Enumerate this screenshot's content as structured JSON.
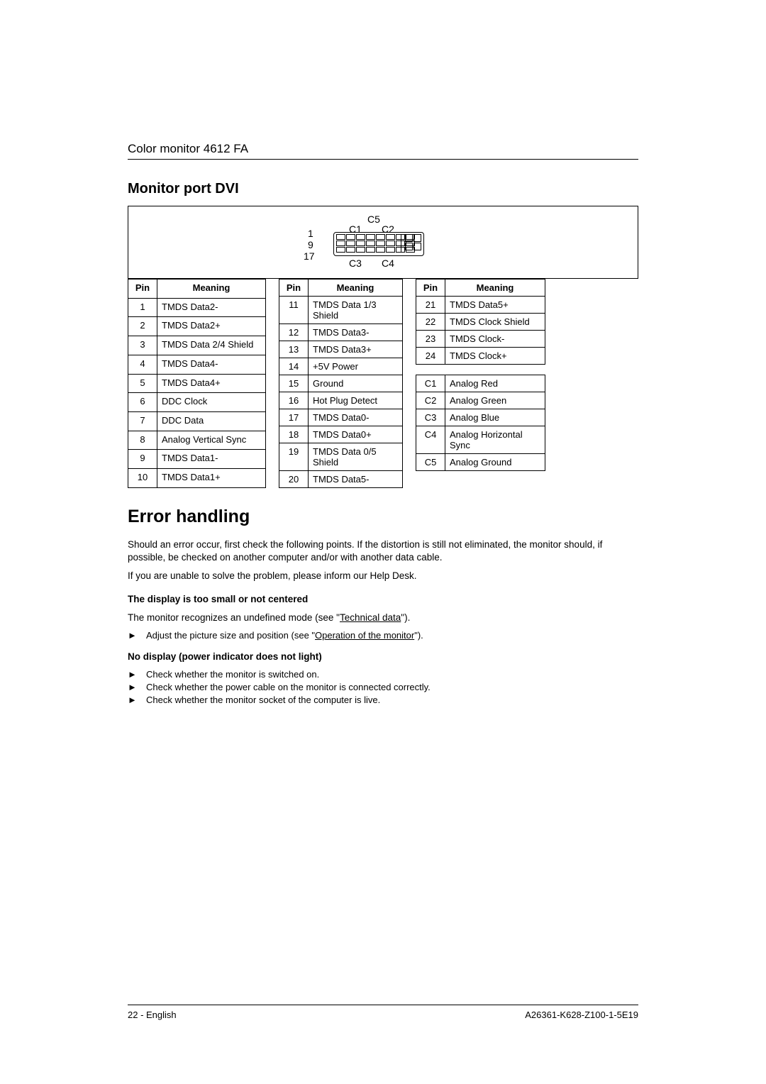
{
  "header": {
    "product": "Color monitor 4612 FA"
  },
  "section1": {
    "title": "Monitor port DVI"
  },
  "diagram": {
    "labels": {
      "l1": "1",
      "l9": "9",
      "l17": "17",
      "c1": "C1",
      "c2": "C2",
      "c3": "C3",
      "c4": "C4",
      "c5": "C5"
    }
  },
  "table_headers": {
    "pin": "Pin",
    "meaning": "Meaning"
  },
  "table1": [
    {
      "pin": "1",
      "meaning": "TMDS Data2-"
    },
    {
      "pin": "2",
      "meaning": "TMDS Data2+"
    },
    {
      "pin": "3",
      "meaning": "TMDS Data 2/4 Shield"
    },
    {
      "pin": "4",
      "meaning": "TMDS Data4-"
    },
    {
      "pin": "5",
      "meaning": "TMDS Data4+"
    },
    {
      "pin": "6",
      "meaning": "DDC Clock"
    },
    {
      "pin": "7",
      "meaning": "DDC Data"
    },
    {
      "pin": "8",
      "meaning": "Analog Vertical Sync"
    },
    {
      "pin": "9",
      "meaning": "TMDS Data1-"
    },
    {
      "pin": "10",
      "meaning": "TMDS Data1+"
    }
  ],
  "table2": [
    {
      "pin": "11",
      "meaning": "TMDS Data 1/3 Shield"
    },
    {
      "pin": "12",
      "meaning": "TMDS Data3-"
    },
    {
      "pin": "13",
      "meaning": "TMDS Data3+"
    },
    {
      "pin": "14",
      "meaning": "+5V Power"
    },
    {
      "pin": "15",
      "meaning": "Ground"
    },
    {
      "pin": "16",
      "meaning": "Hot Plug Detect"
    },
    {
      "pin": "17",
      "meaning": "TMDS Data0-"
    },
    {
      "pin": "18",
      "meaning": "TMDS Data0+"
    },
    {
      "pin": "19",
      "meaning": "TMDS Data 0/5 Shield"
    },
    {
      "pin": "20",
      "meaning": "TMDS Data5-"
    }
  ],
  "table3": [
    {
      "pin": "21",
      "meaning": "TMDS Data5+"
    },
    {
      "pin": "22",
      "meaning": "TMDS Clock Shield"
    },
    {
      "pin": "23",
      "meaning": "TMDS Clock-"
    },
    {
      "pin": "24",
      "meaning": "TMDS Clock+"
    }
  ],
  "table4": [
    {
      "pin": "C1",
      "meaning": "Analog Red"
    },
    {
      "pin": "C2",
      "meaning": "Analog Green"
    },
    {
      "pin": "C3",
      "meaning": "Analog Blue"
    },
    {
      "pin": "C4",
      "meaning": "Analog Horizontal Sync"
    },
    {
      "pin": "C5",
      "meaning": "Analog Ground"
    }
  ],
  "section2": {
    "title": "Error handling",
    "intro1": "Should an error occur, first check the following points. If the distortion is still not eliminated, the monitor should, if possible, be checked on another computer and/or with another data cable.",
    "intro2": "If you are unable to solve the problem, please inform our Help Desk.",
    "sub1_title": "The display is too small or not centered",
    "sub1_text_pre": "The monitor recognizes an undefined mode (see \"",
    "sub1_link": "Technical data",
    "sub1_text_post": "\").",
    "sub1_bullet_pre": "Adjust the picture size and position (see \"",
    "sub1_bullet_link": "Operation of the monitor",
    "sub1_bullet_post": "\").",
    "sub2_title": "No display (power indicator does not light)",
    "sub2_bullets": [
      "Check whether the monitor is switched on.",
      "Check whether the power cable on the monitor is connected correctly.",
      "Check whether the monitor socket of the computer is live."
    ]
  },
  "footer": {
    "left": "22 - English",
    "right": "A26361-K628-Z100-1-5E19"
  },
  "chart_data": {
    "type": "table",
    "title": "DVI connector pinout",
    "groups": [
      {
        "columns": [
          "Pin",
          "Meaning"
        ],
        "rows": [
          [
            "1",
            "TMDS Data2-"
          ],
          [
            "2",
            "TMDS Data2+"
          ],
          [
            "3",
            "TMDS Data 2/4 Shield"
          ],
          [
            "4",
            "TMDS Data4-"
          ],
          [
            "5",
            "TMDS Data4+"
          ],
          [
            "6",
            "DDC Clock"
          ],
          [
            "7",
            "DDC Data"
          ],
          [
            "8",
            "Analog Vertical Sync"
          ],
          [
            "9",
            "TMDS Data1-"
          ],
          [
            "10",
            "TMDS Data1+"
          ]
        ]
      },
      {
        "columns": [
          "Pin",
          "Meaning"
        ],
        "rows": [
          [
            "11",
            "TMDS Data 1/3 Shield"
          ],
          [
            "12",
            "TMDS Data3-"
          ],
          [
            "13",
            "TMDS Data3+"
          ],
          [
            "14",
            "+5V Power"
          ],
          [
            "15",
            "Ground"
          ],
          [
            "16",
            "Hot Plug Detect"
          ],
          [
            "17",
            "TMDS Data0-"
          ],
          [
            "18",
            "TMDS Data0+"
          ],
          [
            "19",
            "TMDS Data 0/5 Shield"
          ],
          [
            "20",
            "TMDS Data5-"
          ]
        ]
      },
      {
        "columns": [
          "Pin",
          "Meaning"
        ],
        "rows": [
          [
            "21",
            "TMDS Data5+"
          ],
          [
            "22",
            "TMDS Clock Shield"
          ],
          [
            "23",
            "TMDS Clock-"
          ],
          [
            "24",
            "TMDS Clock+"
          ]
        ]
      },
      {
        "columns": [
          "Pin",
          "Meaning"
        ],
        "rows": [
          [
            "C1",
            "Analog Red"
          ],
          [
            "C2",
            "Analog Green"
          ],
          [
            "C3",
            "Analog Blue"
          ],
          [
            "C4",
            "Analog Horizontal Sync"
          ],
          [
            "C5",
            "Analog Ground"
          ]
        ]
      }
    ]
  }
}
